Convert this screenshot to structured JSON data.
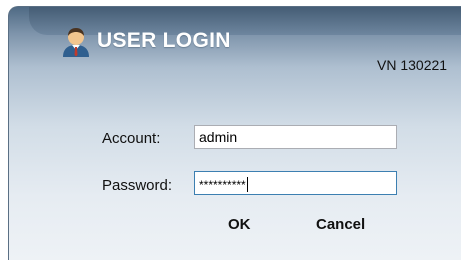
{
  "window": {
    "title": "USER LOGIN",
    "version": "VN 130221"
  },
  "form": {
    "account": {
      "label": "Account:",
      "value": "admin"
    },
    "password": {
      "label": "Password:",
      "masked_value": "**********"
    }
  },
  "buttons": {
    "ok_label": "OK",
    "cancel_label": "Cancel"
  },
  "icons": {
    "title_icon": "user-icon"
  },
  "colors": {
    "title_text": "#ffffff",
    "header_dark": "#4f6a84",
    "panel_light": "#eef2f6",
    "focus_border": "#3c7fb1"
  }
}
